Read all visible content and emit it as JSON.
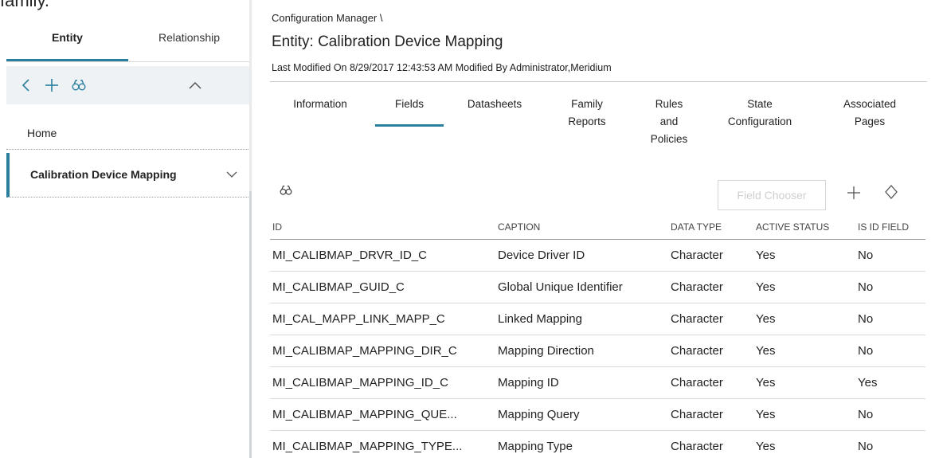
{
  "top_fragment": "family.",
  "left_pane": {
    "tabs": [
      {
        "label": "Entity",
        "active": true
      },
      {
        "label": "Relationship",
        "active": false
      }
    ],
    "toolbar": {
      "back_icon": "chevron-left-icon",
      "add_icon": "plus-icon",
      "find_icon": "binoculars-icon",
      "collapse_icon": "chevron-up-icon"
    },
    "nav": [
      {
        "label": "Home"
      },
      {
        "label": "Calibration Device Mapping",
        "selected": true
      }
    ]
  },
  "header": {
    "breadcrumb": "Configuration Manager \\",
    "title": "Entity: Calibration Device Mapping",
    "modified": "Last Modified On 8/29/2017 12:43:53 AM Modified By Administrator,Meridium"
  },
  "tabs": [
    {
      "line1": "Information",
      "line2": "",
      "line3": ""
    },
    {
      "line1": "Fields",
      "line2": "",
      "line3": "",
      "active": true
    },
    {
      "line1": "Datasheets",
      "line2": "",
      "line3": ""
    },
    {
      "line1": "Family",
      "line2": "Reports",
      "line3": ""
    },
    {
      "line1": "Rules",
      "line2": "and",
      "line3": "Policies"
    },
    {
      "line1": "State",
      "line2": "Configuration",
      "line3": ""
    },
    {
      "line1": "Associated",
      "line2": "Pages",
      "line3": ""
    }
  ],
  "grid_toolbar": {
    "field_chooser_label": "Field Chooser",
    "find_icon": "binoculars-icon",
    "add_icon": "plus-icon",
    "sort_icon": "diamond-sort-icon"
  },
  "table": {
    "columns": [
      "ID",
      "CAPTION",
      "DATA TYPE",
      "ACTIVE STATUS",
      "IS ID FIELD"
    ],
    "rows": [
      [
        "MI_CALIBMAP_DRVR_ID_C",
        "Device Driver ID",
        "Character",
        "Yes",
        "No"
      ],
      [
        "MI_CALIBMAP_GUID_C",
        "Global Unique Identifier",
        "Character",
        "Yes",
        "No"
      ],
      [
        "MI_CAL_MAPP_LINK_MAPP_C",
        "Linked Mapping",
        "Character",
        "Yes",
        "No"
      ],
      [
        "MI_CALIBMAP_MAPPING_DIR_C",
        "Mapping Direction",
        "Character",
        "Yes",
        "No"
      ],
      [
        "MI_CALIBMAP_MAPPING_ID_C",
        "Mapping ID",
        "Character",
        "Yes",
        "Yes"
      ],
      [
        "MI_CALIBMAP_MAPPING_QUE...",
        "Mapping Query",
        "Character",
        "Yes",
        "No"
      ],
      [
        "MI_CALIBMAP_MAPPING_TYPE...",
        "Mapping Type",
        "Character",
        "Yes",
        "No"
      ]
    ]
  },
  "colors": {
    "accent": "#2a7f9e",
    "toolbar_bg": "#eef2f5",
    "disabled_text": "#cfcfcf"
  }
}
